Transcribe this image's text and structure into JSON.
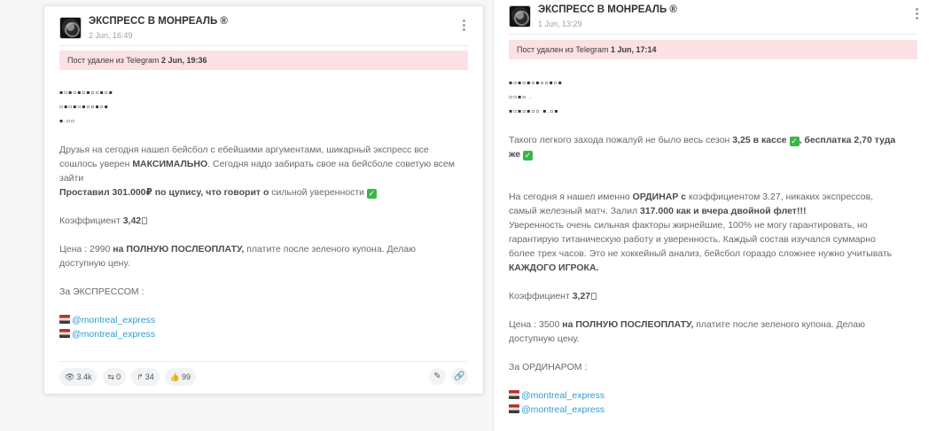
{
  "posts": [
    {
      "channel_name": "ЭКСПРЕСС В МОНРЕАЛЬ ®",
      "date": "2 Jun, 16:49",
      "deleted_notice": "Пост удален из Telegram",
      "deleted_time": "2 Jun, 19:36",
      "squares_lines": [
        "▪▫▪▫▪▫▪▫▫▪▫▪",
        "▫▪▫▪▫▪▫▫▪▫▪",
        "▪.▫▫"
      ],
      "para1_a": "Друзья на сегодня нашел бейсбол с ебейшими аргументами, шикарный экспресс все сошлось уверен ",
      "para1_b": "МАКСИМАЛЬНО",
      "para1_c": ". Сегодня надо забирать свое на бейсболе советую всем зайти",
      "para2_a": "Проставил 301.000₽ по цупису, что говорит о",
      "para2_b": " сильной уверенности ",
      "coef_label": "Коэффициент ",
      "coef_value": "3,42",
      "price_a": "Цена : 2990 ",
      "price_b": "на ПОЛНУЮ ПОСЛЕОПЛАТУ,",
      "price_c": " платите после зеленого купона. Делаю доступную цену.",
      "for_label": "За ЭКСПРЕССОМ :",
      "links": [
        "@montreal_express",
        "@montreal_express"
      ],
      "stats": {
        "views": "3.4k",
        "shares": "0",
        "forwards": "34",
        "likes": "99"
      }
    },
    {
      "channel_name": "ЭКСПРЕСС В МОНРЕАЛЬ ®",
      "date": "1 Jun, 13:29",
      "deleted_notice": "Пост удален из Telegram",
      "deleted_time": "1 Jun, 17:14",
      "squares_lines": [
        "▪▫▪▫▪▫▪▫▫▪▫▪",
        "▫▫▪▫ .",
        "▪▫▪▫▪▫▫ ▪.▫▪"
      ],
      "intro_a": "Такого легкого захода пожалуй не было весь сезон ",
      "intro_b": "3,25 в кассе",
      "intro_c": ", бесплатка 2,70 туда же",
      "para1_a": "На сегодня я нашел именно ",
      "para1_b": "ОРДИНАР с",
      "para1_c": " коэффициентом 3.27, никаких экспрессов, самый железный матч. Залил ",
      "para1_d": "317.000 как и вчера двойной флет!!!",
      "para1_e": "Уверенность очень сильная факторы жирнейшие, 100% не могу гарантировать, но гарантирую титаническую работу и уверенность. Каждый состав изучался суммарно более трех часов. Это не хоккейный анализ, бейсбол гораздо сложнее нужно учитывать ",
      "para1_f": "КАЖДОГО ИГРОКА.",
      "coef_label": "Коэффициент ",
      "coef_value": "3,27",
      "price_a": "Цена : 3500 ",
      "price_b": "на ПОЛНУЮ ПОСЛЕОПЛАТУ,",
      "price_c": " платите после зеленого купона. Делаю доступную цену.",
      "for_label": "За ОРДИНАРОМ :",
      "links": [
        "@montreal_express",
        "@montreal_express"
      ]
    }
  ],
  "icons": {
    "check": "✓",
    "eye": "👁",
    "share": "⇆",
    "forward": "↱",
    "like": "👍",
    "edit": "✎",
    "link": "🔗"
  }
}
